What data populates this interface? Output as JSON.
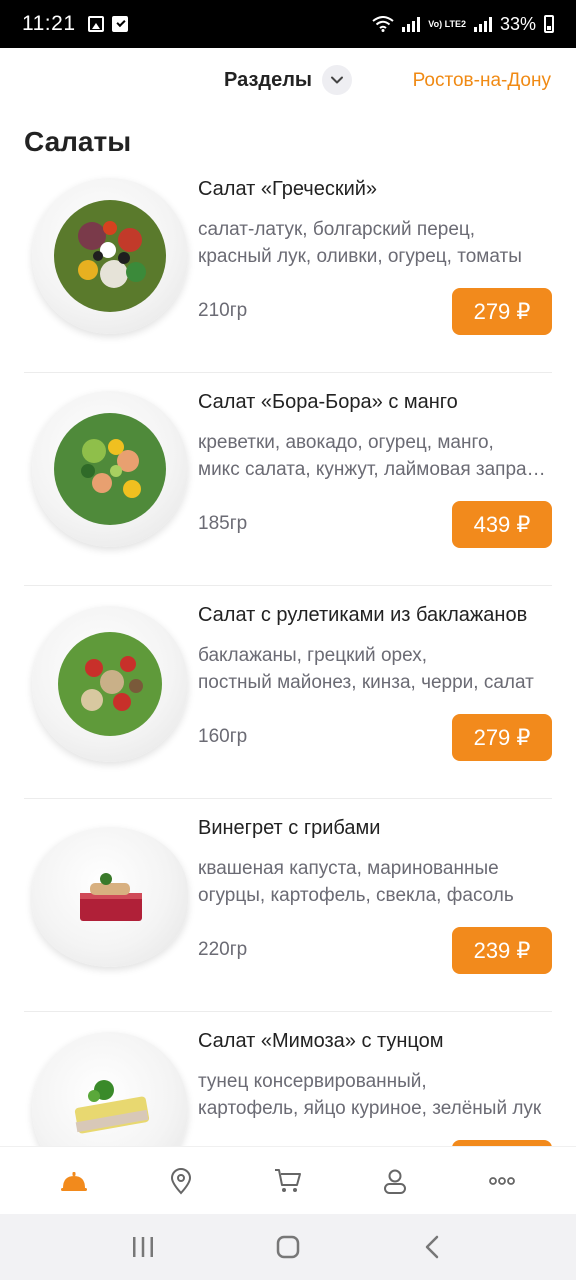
{
  "status_bar": {
    "time": "11:21",
    "battery": "33%",
    "network": "Vo) LTE2",
    "icons": [
      "image-icon",
      "check-box-icon",
      "wifi-icon",
      "signal-icon",
      "battery-icon"
    ]
  },
  "header": {
    "sections_label": "Разделы",
    "city": "Ростов-на-Дону"
  },
  "section_title": "Салаты",
  "colors": {
    "accent": "#f28a1c",
    "city_text": "#f08a14",
    "text_primary": "#222222",
    "text_secondary": "#6b6b74"
  },
  "items": [
    {
      "name": "Салат «Греческий»",
      "desc_line1": "салат-латук, болгарский перец,",
      "desc_line2": "красный лук, оливки, огурец, томаты",
      "weight": "210гр",
      "price": "279 ₽"
    },
    {
      "name": "Салат «Бора-Бора» с манго",
      "desc_line1": "креветки, авокадо, огурец, манго,",
      "desc_line2": "микс салата, кунжут, лаймовая заправка",
      "weight": "185гр",
      "price": "439 ₽"
    },
    {
      "name": "Салат с рулетиками из баклажанов",
      "desc_line1": "баклажаны, грецкий орех,",
      "desc_line2": "постный майонез, кинза, черри, салат",
      "weight": "160гр",
      "price": "279 ₽"
    },
    {
      "name": "Винегрет с грибами",
      "desc_line1": "квашеная капуста, маринованные",
      "desc_line2": "огурцы, картофель, свекла, фасоль",
      "weight": "220гр",
      "price": "239 ₽"
    },
    {
      "name": "Салат «Мимоза» с тунцом",
      "desc_line1": "тунец консервированный,",
      "desc_line2": "картофель, яйцо куриное, зелёный лук",
      "weight": "",
      "price": ""
    }
  ],
  "tabbar": {
    "tabs": [
      "menu-bell-icon",
      "location-pin-icon",
      "cart-icon",
      "profile-icon",
      "more-icon"
    ],
    "active_tab": "menu-bell-icon"
  },
  "navbar": {
    "buttons": [
      "recent-apps-icon",
      "home-icon",
      "back-icon"
    ]
  }
}
